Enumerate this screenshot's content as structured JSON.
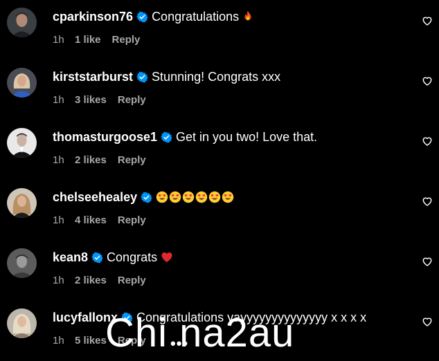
{
  "comments": [
    {
      "username": "cparkinson76",
      "text": "Congratulations",
      "emoji": "fire",
      "time": "1h",
      "likes": "1 like",
      "reply": "Reply",
      "verified": true
    },
    {
      "username": "kirststarburst",
      "text": "Stunning! Congrats xxx",
      "time": "1h",
      "likes": "3 likes",
      "reply": "Reply",
      "verified": true
    },
    {
      "username": "thomasturgoose1",
      "text": "Get in you two! Love that.",
      "time": "1h",
      "likes": "2 likes",
      "reply": "Reply",
      "verified": true
    },
    {
      "username": "chelseehealey",
      "text": "",
      "emoji": "heart-eyes-face",
      "emoji_count": 6,
      "time": "1h",
      "likes": "4 likes",
      "reply": "Reply",
      "verified": true
    },
    {
      "username": "kean8",
      "text": "Congrats",
      "emoji": "red-heart",
      "time": "1h",
      "likes": "2 likes",
      "reply": "Reply",
      "verified": true
    },
    {
      "username": "lucyfallonx",
      "text": "Congratulations yayyyyyyyyyyyyyy x x x x",
      "time": "1h",
      "likes": "5 likes",
      "reply": "Reply",
      "verified": true
    }
  ],
  "more_indicator": "•••",
  "watermark": "Chi na2au",
  "colors": {
    "background": "#000000",
    "text": "#ffffff",
    "meta": "#a8a8a8",
    "verified": "#0095f6"
  },
  "icons": {
    "verified": "verified-badge-icon",
    "like": "heart-outline-icon"
  }
}
